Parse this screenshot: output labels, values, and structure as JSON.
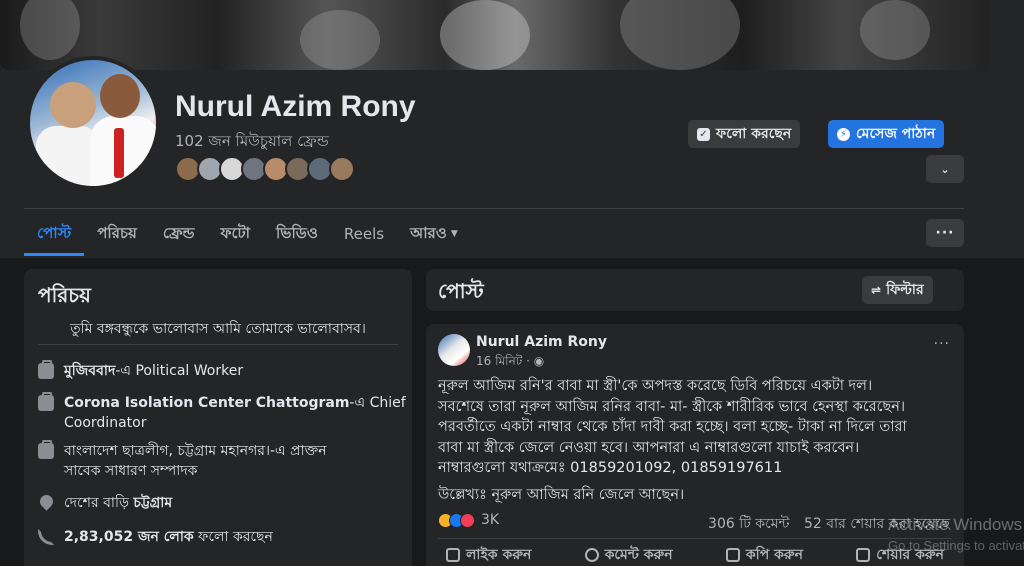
{
  "profile": {
    "name": "Nurul Azim Rony",
    "mutual_friends": "102 জন মিউচুয়াল ফ্রেন্ড",
    "friend_avatar_colors": [
      "#8b6b4a",
      "#a0a6b0",
      "#d8d8d8",
      "#6e7480",
      "#b88c6a",
      "#7a6a5a",
      "#5c6b7a",
      "#9a7a5c"
    ]
  },
  "actions": {
    "following_label": "ফলো করছেন",
    "message_label": "মেসেজ পাঠান",
    "more_chevron": "⌄",
    "dots": "···"
  },
  "tabs": [
    {
      "label": "পোস্ট",
      "active": true
    },
    {
      "label": "পরিচয়"
    },
    {
      "label": "ফ্রেন্ড"
    },
    {
      "label": "ফটো"
    },
    {
      "label": "ভিডিও"
    },
    {
      "label": "Reels"
    },
    {
      "label": "আরও",
      "dropdown": true
    }
  ],
  "intro": {
    "title": "পরিচয়",
    "bio": "তুমি বঙ্গবন্ধুকে ভালোবাস আমি তোমাকে ভালোবাসব।",
    "work1_place": "মুজিববাদ",
    "work1_role": "-এ Political Worker",
    "work2_place": "Corona Isolation Center Chattogram",
    "work2_role": "-এ Chief",
    "work2_role_line2": "Coordinator",
    "edu_line1": "বাংলাদেশ ছাত্রলীগ, চট্টগ্রাম মহানগর।-এ প্রাক্তন",
    "edu_line2": "সাবেক সাধারণ সম্পাদক",
    "home_prefix": "দেশের বাড়ি",
    "home_place": "চট্টগ্রাম",
    "followers_count": "2,83,052 জন লোক",
    "followers_suffix": "ফলো করছেন"
  },
  "posts_section": {
    "title": "পোস্ট",
    "filter_label": "ফিল্টার"
  },
  "post": {
    "author": "Nurul Azim Rony",
    "time": "16 মিনিট",
    "privacy_icon": "globe-icon",
    "lines": [
      "নূরুল আজিম রনি'র বাবা মা স্ত্রী'কে অপদস্ত করেছে ডিবি পরিচয়ে একটা দল।",
      "সবশেষে তারা নূরুল আজিম রনির বাবা- মা- স্ত্রীকে শারীরিক ভাবে হেনস্থা করেছেন।",
      "পরবর্তীতে একটা নাম্বার থেকে চাঁদা দাবী করা হচ্ছে। বলা হচ্ছে- টাকা না দিলে তারা",
      "বাবা মা স্ত্রীকে জেলে নেওয়া হবে। আপনারা এ নাম্বারগুলো যাচাই করবেন।",
      "নাম্বারগুলো যথাক্রমেঃ 01859201092, 01859197611"
    ],
    "note": "উল্লেখ্যঃ নূরুল আজিম রনি জেলে আছেন।",
    "reaction_count": "3K",
    "comments": "306 টি কমেন্ট",
    "shares": "52 বার শেয়ার করা হয়েছে",
    "like_label": "লাইক করুন",
    "comment_label": "কমেন্ট করুন",
    "copy_label": "কপি করুন",
    "share_label": "শেয়ার করুন"
  },
  "watermark": {
    "line1": "Activate Windows",
    "line2": "Go to Settings to activate"
  }
}
